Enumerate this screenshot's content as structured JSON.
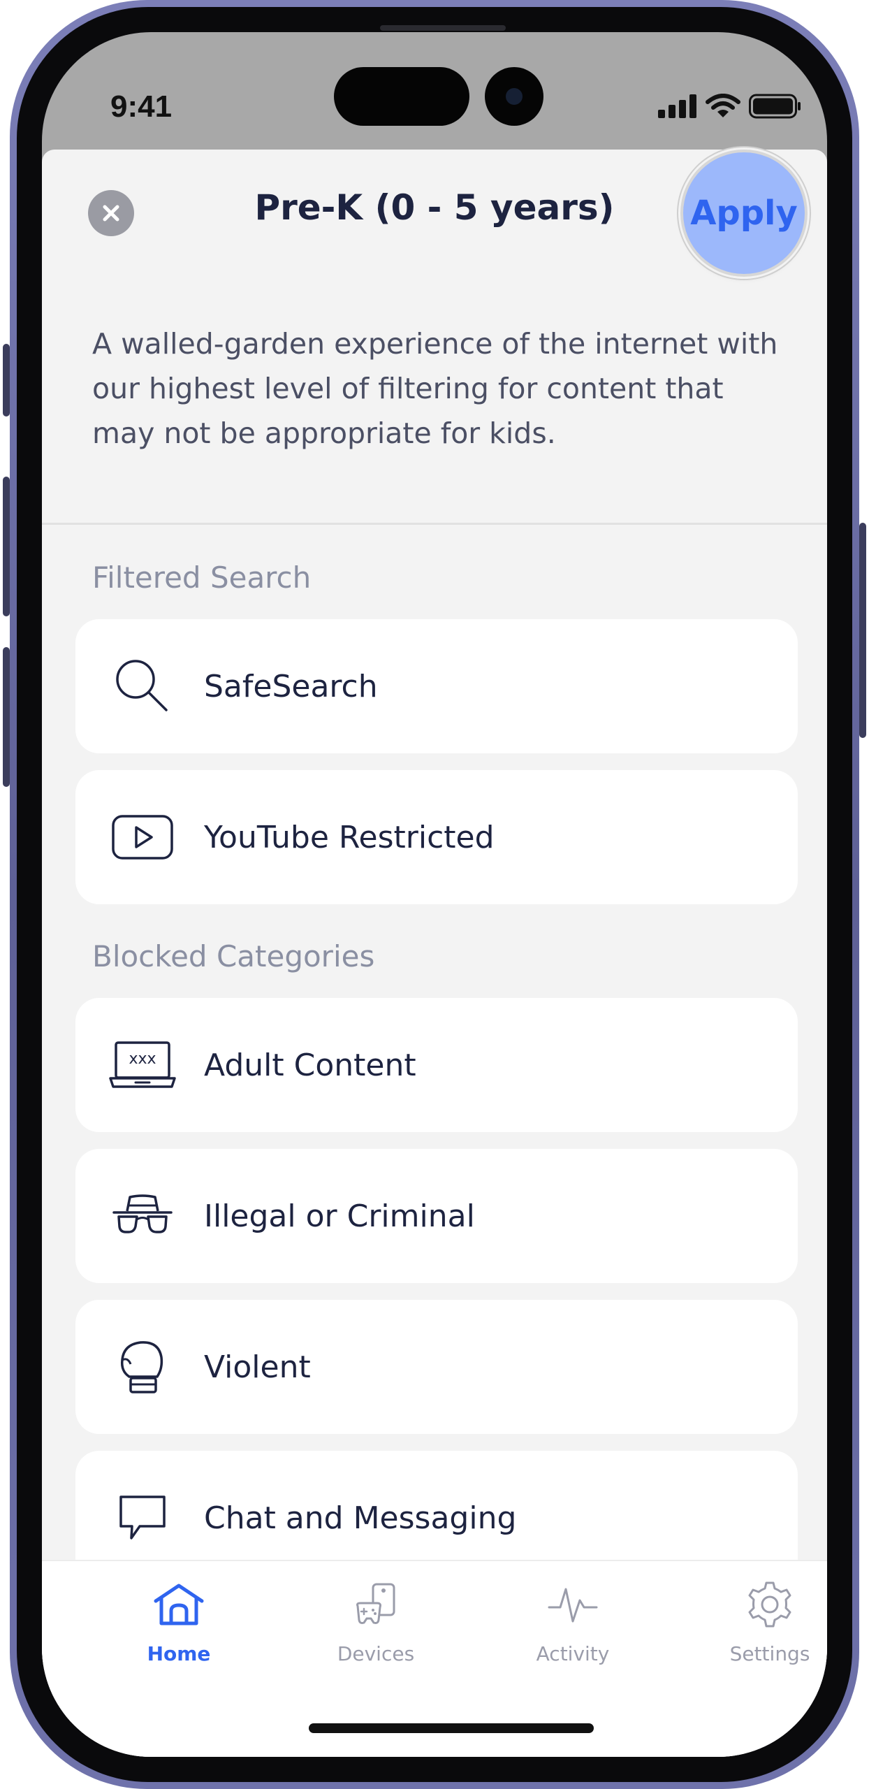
{
  "status_bar": {
    "time": "9:41"
  },
  "sheet": {
    "title": "Pre-K (0 - 5 years)",
    "apply_label": "Apply",
    "description": "A walled-garden experience of the internet with our highest level of filtering for content that may not be appropriate for kids."
  },
  "sections": {
    "filtered_search": {
      "heading": "Filtered Search",
      "items": [
        {
          "label": "SafeSearch",
          "icon": "magnifier-icon"
        },
        {
          "label": "YouTube Restricted",
          "icon": "play-icon"
        }
      ]
    },
    "blocked_categories": {
      "heading": "Blocked Categories",
      "items": [
        {
          "label": "Adult Content",
          "icon": "laptop-xxx-icon",
          "icon_text": "xxx"
        },
        {
          "label": "Illegal or Criminal",
          "icon": "spy-icon"
        },
        {
          "label": "Violent",
          "icon": "boxing-glove-icon"
        },
        {
          "label": "Chat and Messaging",
          "icon": "chat-bubble-icon"
        }
      ]
    }
  },
  "tabbar": {
    "tabs": [
      {
        "label": "Home",
        "icon": "home-icon",
        "active": true
      },
      {
        "label": "Devices",
        "icon": "devices-icon",
        "active": false
      },
      {
        "label": "Activity",
        "icon": "activity-icon",
        "active": false
      },
      {
        "label": "Settings",
        "icon": "gear-icon",
        "active": false
      }
    ]
  },
  "colors": {
    "accent": "#2f64ef",
    "apply_bg": "#9cb8fb",
    "text_primary": "#1d2340",
    "text_muted": "#8a8fa2",
    "sheet_bg": "#f3f3f3",
    "device_frame": "#6f72ab"
  }
}
